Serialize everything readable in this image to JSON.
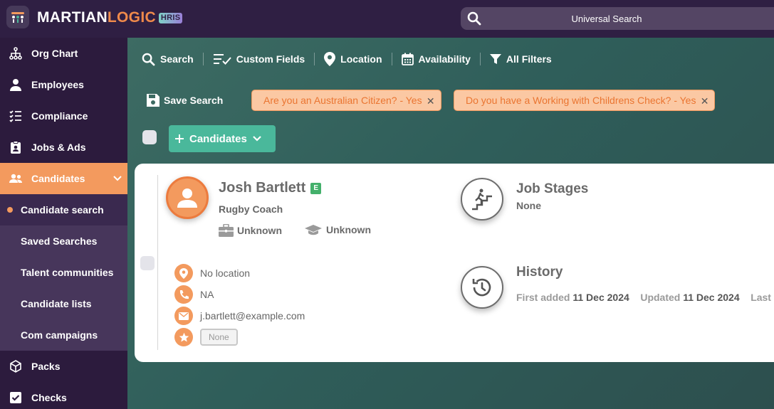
{
  "brand": {
    "martian": "MARTIAN",
    "logic": "LOGIC",
    "hris": "HRIS"
  },
  "search": {
    "placeholder": "Universal Search"
  },
  "sidebar": {
    "items": [
      {
        "label": "Org Chart",
        "icon": "org-chart-icon"
      },
      {
        "label": "Employees",
        "icon": "employees-icon"
      },
      {
        "label": "Compliance",
        "icon": "compliance-icon"
      },
      {
        "label": "Jobs & Ads",
        "icon": "jobs-ads-icon"
      },
      {
        "label": "Candidates",
        "icon": "candidates-icon"
      }
    ],
    "subitems": [
      {
        "label": "Candidate search"
      },
      {
        "label": "Saved Searches"
      },
      {
        "label": "Talent communities"
      },
      {
        "label": "Candidate lists"
      },
      {
        "label": "Com campaigns"
      }
    ],
    "bottom": [
      {
        "label": "Packs",
        "icon": "packs-icon"
      },
      {
        "label": "Checks",
        "icon": "checks-icon"
      }
    ]
  },
  "toolbar": {
    "search": "Search",
    "custom_fields": "Custom Fields",
    "location": "Location",
    "availability": "Availability",
    "all_filters": "All Filters",
    "save_search": "Save Search"
  },
  "filters": [
    {
      "label": "Are you an Australian Citizen? - Yes"
    },
    {
      "label": "Do you have a Working with Childrens Check? - Yes"
    }
  ],
  "candidates_button": "Candidates",
  "candidate": {
    "name": "Josh Bartlett",
    "badge": "E",
    "role": "Rugby Coach",
    "employment": "Unknown",
    "education": "Unknown",
    "location": "No location",
    "phone": "NA",
    "email": "j.bartlett@example.com",
    "rating": "None"
  },
  "job_stages": {
    "title": "Job Stages",
    "value": "None"
  },
  "history": {
    "title": "History",
    "first_added_label": "First added",
    "first_added": "11 Dec 2024",
    "updated_label": "Updated",
    "updated": "11 Dec 2024",
    "last_label": "Last"
  },
  "colors": {
    "accent": "#f39a5e",
    "green": "#4ab89b",
    "sidebar": "#2c1b3d"
  }
}
